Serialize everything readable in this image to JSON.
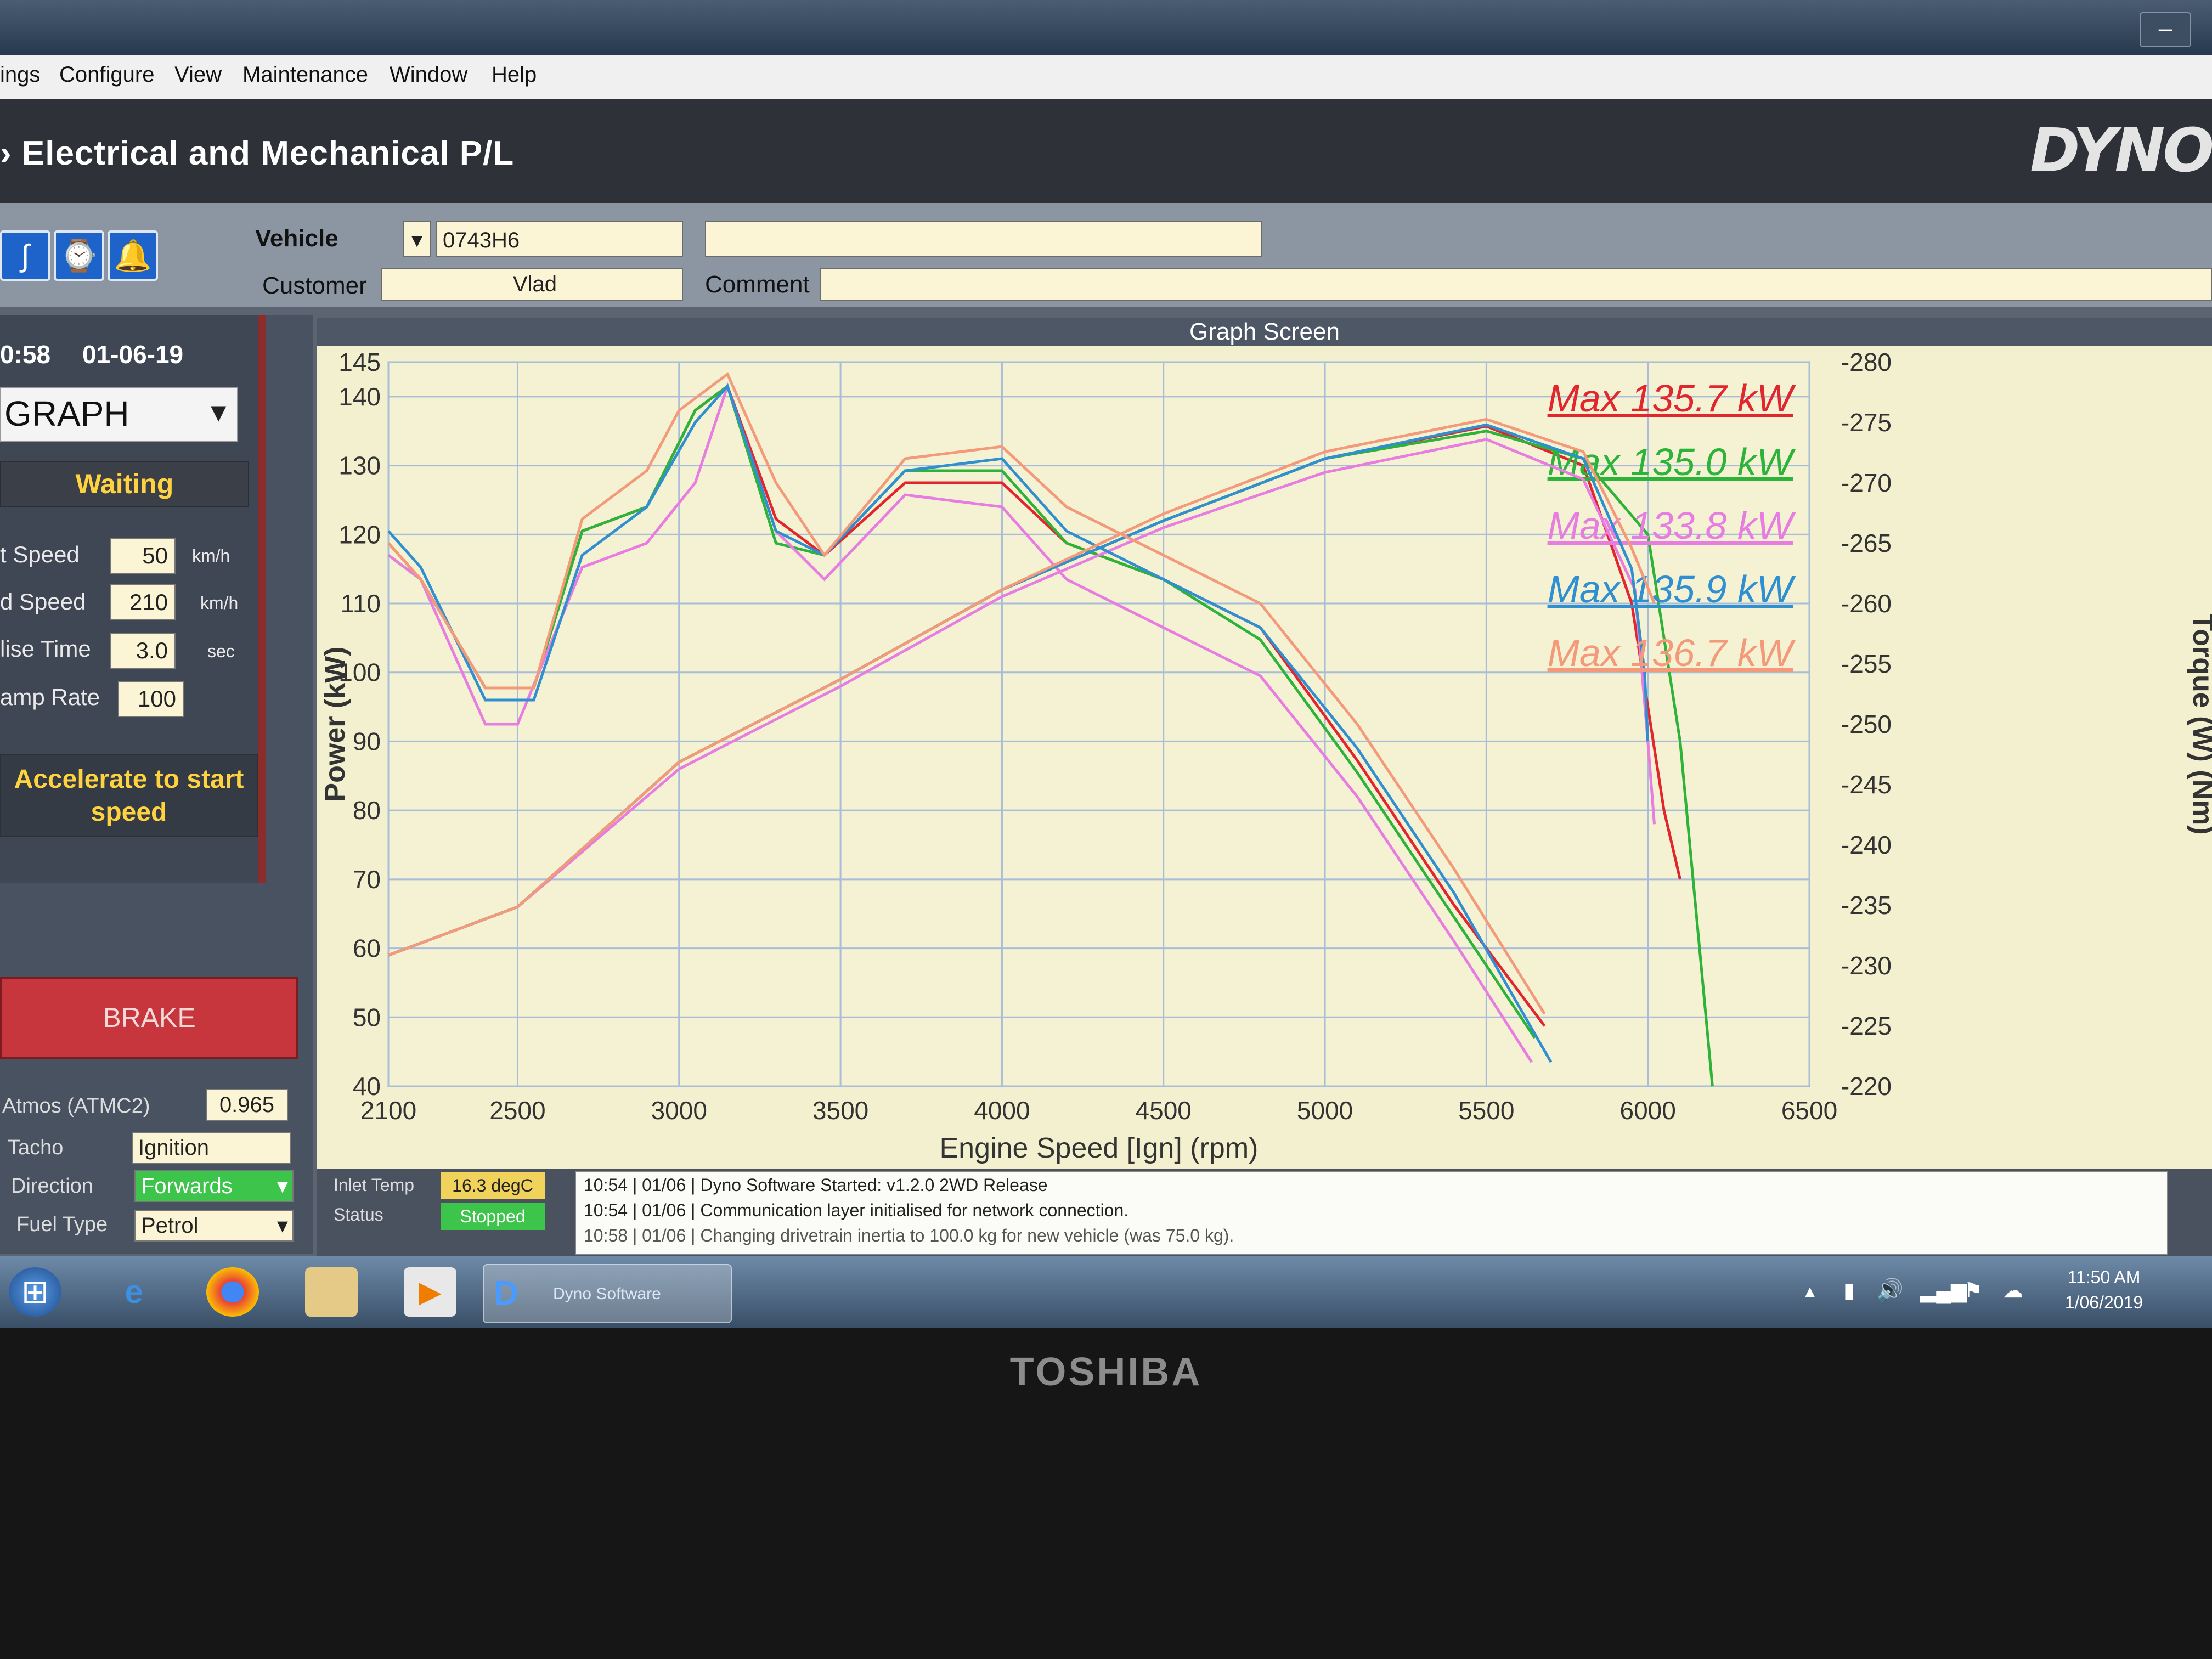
{
  "menu": [
    "ings",
    "Configure",
    "View",
    "Maintenance",
    "Window",
    "Help"
  ],
  "app_title": "› Electrical and Mechanical P/L",
  "logo_text": "DYNO",
  "vehicle": {
    "label": "Vehicle",
    "value": "0743H6"
  },
  "customer": {
    "label": "Customer",
    "value": "Vlad"
  },
  "comment": {
    "label": "Comment",
    "value": ""
  },
  "left": {
    "time": "0:58",
    "date": "01-06-19",
    "mode": "GRAPH",
    "state": "Waiting",
    "params": [
      {
        "label": "t Speed",
        "value": "50",
        "unit": "km/h"
      },
      {
        "label": "d Speed",
        "value": "210",
        "unit": "km/h"
      },
      {
        "label": "lise Time",
        "value": "3.0",
        "unit": "sec"
      },
      {
        "label": "amp Rate",
        "value": "100",
        "unit": ""
      }
    ],
    "prompt": "Accelerate to start speed",
    "brake": "BRAKE",
    "atmos_label": "Atmos (ATMC2)",
    "atmos_value": "0.965",
    "tacho_label": "Tacho",
    "tacho_value": "Ignition",
    "direction_label": "Direction",
    "direction_value": "Forwards",
    "fuel_label": "Fuel Type",
    "fuel_value": "Petrol"
  },
  "status": {
    "inlet_label": "Inlet Temp",
    "inlet_value": "16.3 degC",
    "status_label": "Status",
    "status_value": "Stopped",
    "log": [
      "10:54 | 01/06 | Dyno Software Started: v1.2.0 2WD Release",
      "10:54 | 01/06 | Communication layer initialised for network connection.",
      "10:58 | 01/06 | Changing drivetrain inertia to 100.0 kg for new vehicle (was 75.0 kg)."
    ]
  },
  "taskbar": {
    "app": "Dyno Software",
    "time": "11:50 AM",
    "date": "1/06/2019"
  },
  "brand": "TOSHIBA",
  "chart_data": {
    "type": "line",
    "title": "Graph Screen",
    "xlabel": "Engine Speed [Ign] (rpm)",
    "ylabel": "Power (kW)",
    "y2label": "Torque (W) (Nm)",
    "xlim": [
      2100,
      6500
    ],
    "ylim": [
      40,
      145
    ],
    "y2lim": [
      220,
      280
    ],
    "xticks": [
      2100,
      2500,
      3000,
      3500,
      4000,
      4500,
      5000,
      5500,
      6000,
      6500
    ],
    "yticks": [
      40,
      50,
      60,
      70,
      80,
      90,
      100,
      110,
      120,
      130,
      140,
      145
    ],
    "y2ticks": [
      220,
      225,
      230,
      235,
      240,
      245,
      250,
      255,
      260,
      265,
      270,
      275,
      280
    ],
    "legend": [
      "Max 135.7 kW",
      "Max 135.0 kW",
      "Max 133.8 kW",
      "Max 135.9 kW",
      "Max 136.7 kW"
    ],
    "series": [
      {
        "color": "#e2262e",
        "power": [
          [
            2100,
            59
          ],
          [
            2500,
            66
          ],
          [
            3000,
            87
          ],
          [
            3500,
            99
          ],
          [
            4000,
            112
          ],
          [
            4500,
            122
          ],
          [
            5000,
            131
          ],
          [
            5500,
            135.7
          ],
          [
            5800,
            130
          ],
          [
            5950,
            110
          ],
          [
            6050,
            80
          ],
          [
            6100,
            70
          ]
        ],
        "torque": [
          [
            2100,
            265
          ],
          [
            2200,
            262
          ],
          [
            2400,
            253
          ],
          [
            2550,
            253
          ],
          [
            2700,
            266
          ],
          [
            2900,
            268
          ],
          [
            3050,
            276
          ],
          [
            3150,
            278
          ],
          [
            3300,
            267
          ],
          [
            3450,
            264
          ],
          [
            3700,
            270
          ],
          [
            4000,
            270
          ],
          [
            4200,
            265
          ],
          [
            4500,
            262
          ],
          [
            4800,
            258
          ],
          [
            5100,
            247
          ],
          [
            5400,
            235
          ],
          [
            5680,
            225
          ]
        ]
      },
      {
        "color": "#2eb33a",
        "power": [
          [
            2100,
            59
          ],
          [
            2500,
            66
          ],
          [
            3000,
            87
          ],
          [
            3500,
            99
          ],
          [
            4000,
            112
          ],
          [
            4500,
            122
          ],
          [
            5000,
            131
          ],
          [
            5500,
            135
          ],
          [
            5800,
            131
          ],
          [
            6000,
            120
          ],
          [
            6100,
            90
          ],
          [
            6160,
            60
          ],
          [
            6200,
            40
          ]
        ],
        "torque": [
          [
            2100,
            264
          ],
          [
            2200,
            262
          ],
          [
            2400,
            253
          ],
          [
            2550,
            253
          ],
          [
            2700,
            266
          ],
          [
            2900,
            268
          ],
          [
            3050,
            276
          ],
          [
            3150,
            278
          ],
          [
            3300,
            265
          ],
          [
            3450,
            264
          ],
          [
            3700,
            271
          ],
          [
            4000,
            271
          ],
          [
            4200,
            265
          ],
          [
            4500,
            262
          ],
          [
            4800,
            257
          ],
          [
            5100,
            246
          ],
          [
            5400,
            234
          ],
          [
            5650,
            224
          ]
        ]
      },
      {
        "color": "#e77de0",
        "power": [
          [
            2100,
            59
          ],
          [
            2500,
            66
          ],
          [
            3000,
            86
          ],
          [
            3500,
            98
          ],
          [
            4000,
            111
          ],
          [
            4500,
            121
          ],
          [
            5000,
            129
          ],
          [
            5500,
            133.8
          ],
          [
            5800,
            128
          ],
          [
            5960,
            112
          ],
          [
            6000,
            90
          ],
          [
            6020,
            78
          ]
        ],
        "torque": [
          [
            2100,
            264
          ],
          [
            2200,
            262
          ],
          [
            2400,
            250
          ],
          [
            2500,
            250
          ],
          [
            2700,
            263
          ],
          [
            2900,
            265
          ],
          [
            3050,
            270
          ],
          [
            3150,
            278
          ],
          [
            3300,
            266
          ],
          [
            3450,
            262
          ],
          [
            3700,
            269
          ],
          [
            4000,
            268
          ],
          [
            4200,
            262
          ],
          [
            4500,
            258
          ],
          [
            4800,
            254
          ],
          [
            5100,
            244
          ],
          [
            5400,
            232
          ],
          [
            5640,
            222
          ]
        ]
      },
      {
        "color": "#2f8fd0",
        "power": [
          [
            2100,
            59
          ],
          [
            2500,
            66
          ],
          [
            3000,
            87
          ],
          [
            3500,
            99
          ],
          [
            4000,
            112
          ],
          [
            4500,
            122
          ],
          [
            5000,
            131
          ],
          [
            5500,
            135.9
          ],
          [
            5800,
            131
          ],
          [
            5950,
            115
          ],
          [
            5990,
            100
          ],
          [
            6000,
            90
          ]
        ],
        "torque": [
          [
            2100,
            266
          ],
          [
            2200,
            263
          ],
          [
            2400,
            252
          ],
          [
            2550,
            252
          ],
          [
            2700,
            264
          ],
          [
            2900,
            268
          ],
          [
            3050,
            275
          ],
          [
            3150,
            278
          ],
          [
            3300,
            266
          ],
          [
            3450,
            264
          ],
          [
            3700,
            271
          ],
          [
            4000,
            272
          ],
          [
            4200,
            266
          ],
          [
            4500,
            262
          ],
          [
            4800,
            258
          ],
          [
            5100,
            248
          ],
          [
            5400,
            236
          ],
          [
            5700,
            222
          ]
        ]
      },
      {
        "color": "#f39a7a",
        "power": [
          [
            2100,
            59
          ],
          [
            2500,
            66
          ],
          [
            3000,
            87
          ],
          [
            3500,
            99
          ],
          [
            4000,
            112
          ],
          [
            4500,
            123
          ],
          [
            5000,
            132
          ],
          [
            5500,
            136.7
          ],
          [
            5800,
            132
          ],
          [
            5950,
            118
          ],
          [
            6020,
            110
          ]
        ],
        "torque": [
          [
            2100,
            265
          ],
          [
            2200,
            262
          ],
          [
            2400,
            253
          ],
          [
            2550,
            253
          ],
          [
            2700,
            267
          ],
          [
            2900,
            271
          ],
          [
            3000,
            276
          ],
          [
            3150,
            279
          ],
          [
            3300,
            270
          ],
          [
            3450,
            264
          ],
          [
            3700,
            272
          ],
          [
            4000,
            273
          ],
          [
            4200,
            268
          ],
          [
            4500,
            264
          ],
          [
            4800,
            260
          ],
          [
            5100,
            250
          ],
          [
            5400,
            238
          ],
          [
            5680,
            226
          ]
        ]
      }
    ]
  }
}
